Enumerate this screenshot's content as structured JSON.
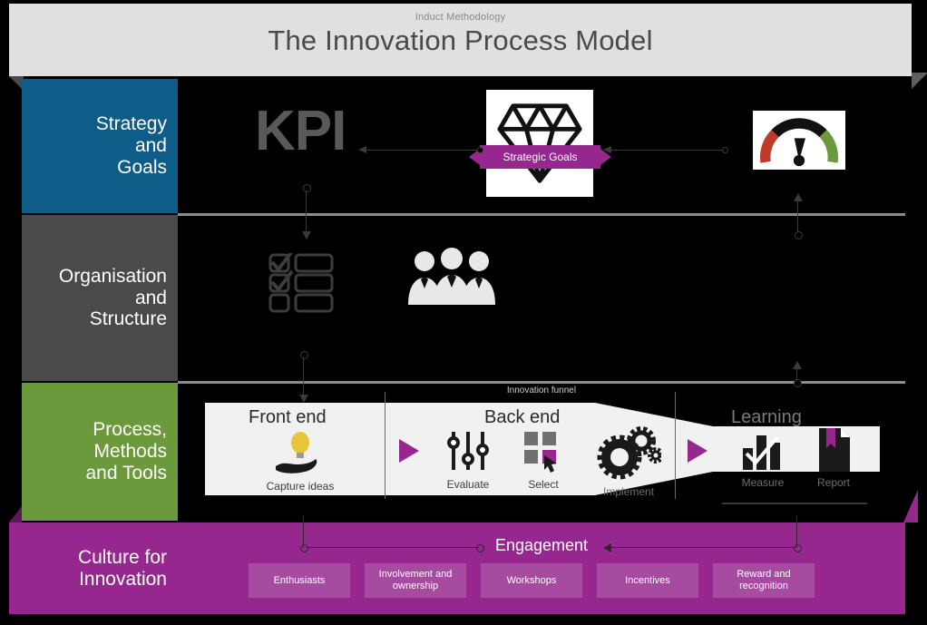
{
  "header": {
    "subtitle": "Induct Methodology",
    "title": "The Innovation Process Model"
  },
  "rows": {
    "strategy": {
      "label_line1": "Strategy",
      "label_line2": "and",
      "label_line3": "Goals",
      "color": "#0d5d88",
      "kpi_label": "KPI",
      "ribbon_label": "Strategic Goals",
      "diamond_icon": "diamond-icon",
      "gauge_icon": "gauge-icon"
    },
    "organisation": {
      "label_line1": "Organisation",
      "label_line2": "and",
      "label_line3": "Structure",
      "color": "#4a4a4a",
      "checklist_icon": "checklist-icon",
      "people_icon": "people-group-icon"
    },
    "process": {
      "label_line1": "Process,",
      "label_line2": "Methods",
      "label_line3": "and Tools",
      "color": "#6b993c",
      "funnel_label": "Innovation funnel",
      "phases": [
        {
          "name": "Front end"
        },
        {
          "name": "Back end"
        },
        {
          "name": "Learning"
        }
      ],
      "stages": [
        {
          "label": "Capture ideas",
          "icon": "lightbulb-hand-icon"
        },
        {
          "label": "Evaluate",
          "icon": "sliders-icon"
        },
        {
          "label": "Select",
          "icon": "grid-cursor-icon"
        },
        {
          "label": "Implement",
          "icon": "gears-icon"
        },
        {
          "label": "Measure",
          "icon": "bar-chart-check-icon"
        },
        {
          "label": "Report",
          "icon": "document-bookmark-icon"
        }
      ]
    },
    "culture": {
      "label_line1": "Culture for",
      "label_line2": "Innovation",
      "color": "#96278e",
      "engagement_title": "Engagement",
      "chips": [
        {
          "label": "Enthusiasts"
        },
        {
          "label": "Involvement and ownership"
        },
        {
          "label": "Workshops"
        },
        {
          "label": "Incentives"
        },
        {
          "label": "Reward and recognition"
        }
      ]
    }
  },
  "colors": {
    "strategy_blue": "#0d5d88",
    "organisation_gray": "#4a4a4a",
    "process_green": "#6b993c",
    "culture_magenta": "#96278e",
    "accent_magenta": "#96278e",
    "header_bg": "#e0e0e0",
    "canvas_bg": "#000000"
  }
}
